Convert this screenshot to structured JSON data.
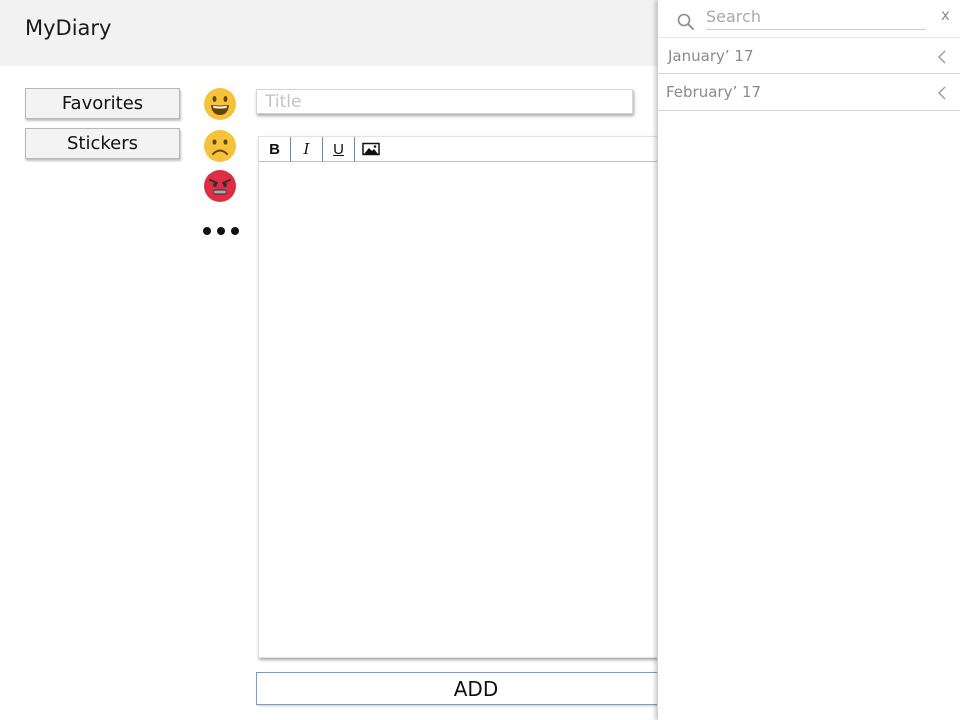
{
  "header": {
    "app_title": "MyDiary"
  },
  "sidebar": {
    "favorites_label": "Favorites",
    "stickers_label": "Stickers"
  },
  "moods": {
    "items": [
      "happy-face-icon",
      "sad-face-icon",
      "angry-face-icon"
    ],
    "more_icon": "more-dots-icon"
  },
  "editor": {
    "title_placeholder": "Title",
    "toolbar": {
      "bold_label": "B",
      "italic_label": "I",
      "underline_label": "U",
      "image_icon": "image-icon"
    }
  },
  "actions": {
    "add_label": "ADD"
  },
  "panel": {
    "search_placeholder": "Search",
    "close_label": "x",
    "months": [
      {
        "label": "January’ 17"
      },
      {
        "label": "February’ 17"
      }
    ]
  },
  "colors": {
    "header_bg": "#f2f2f2",
    "emoji_yellow": "#f5c33b",
    "emoji_red": "#dd2e44",
    "accent_border": "#7a9cc6"
  }
}
